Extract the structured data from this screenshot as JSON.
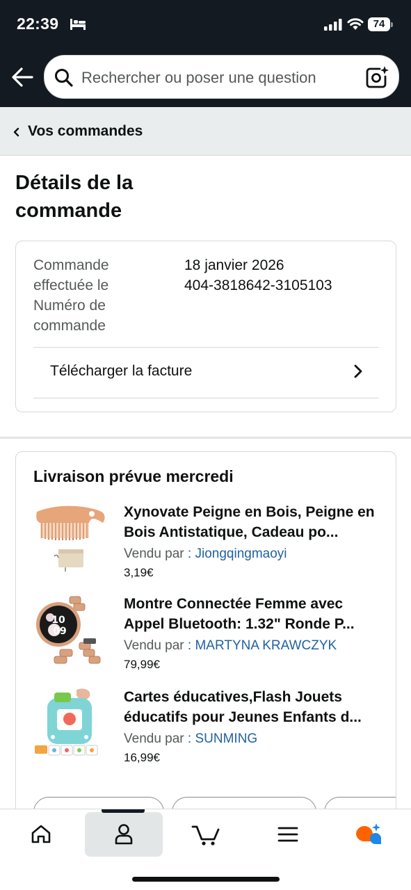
{
  "status_bar": {
    "time": "22:39",
    "battery": "74",
    "icons": [
      "bed-icon",
      "signal-icon",
      "wifi-icon",
      "battery-icon"
    ]
  },
  "header": {
    "back_icon": "arrow-left-icon",
    "search_placeholder": "Rechercher ou poser une question",
    "search_icon": "search-icon",
    "camera_icon": "camera-sparkle-icon"
  },
  "breadcrumb": {
    "label": "Vos commandes"
  },
  "page": {
    "title": "Détails de la commande"
  },
  "order_info": {
    "date_label": "Commande effectuée le",
    "date_value": "18 janvier 2026",
    "number_label": "Numéro de commande",
    "number_value": "404-3818642-3105103",
    "invoice_label": "Télécharger la facture"
  },
  "delivery": {
    "title": "Livraison prévue mercredi",
    "seller_prefix": "Vendu par",
    "items": [
      {
        "title": "Xynovate Peigne en Bois, Peigne en Bois Antistatique, Cadeau po...",
        "seller": ": Jiongqingmaoyi",
        "price": "3,19€",
        "image": "wooden-comb-image"
      },
      {
        "title": "Montre Connectée Femme avec Appel Bluetooth: 1.32\" Ronde P...",
        "seller": ": MARTYNA KRAWCZYK",
        "price": "79,99€",
        "image": "smartwatch-image",
        "watch_text": [
          "10",
          "09"
        ]
      },
      {
        "title": "Cartes éducatives,Flash Jouets éducatifs pour Jeunes Enfants d...",
        "seller": ": SUNMING",
        "price": "16,99€",
        "image": "flash-cards-toy-image"
      }
    ]
  },
  "bottom_nav": {
    "items": [
      {
        "name": "home",
        "icon": "home-icon"
      },
      {
        "name": "account",
        "icon": "person-icon",
        "active": true
      },
      {
        "name": "cart",
        "icon": "cart-icon"
      },
      {
        "name": "menu",
        "icon": "hamburger-icon"
      },
      {
        "name": "rufus",
        "icon": "rufus-assistant-icon"
      }
    ]
  },
  "colors": {
    "header_bg": "#131a22",
    "link": "#2162a1",
    "secondary_text": "#565959",
    "divider": "#d5d9d9"
  }
}
